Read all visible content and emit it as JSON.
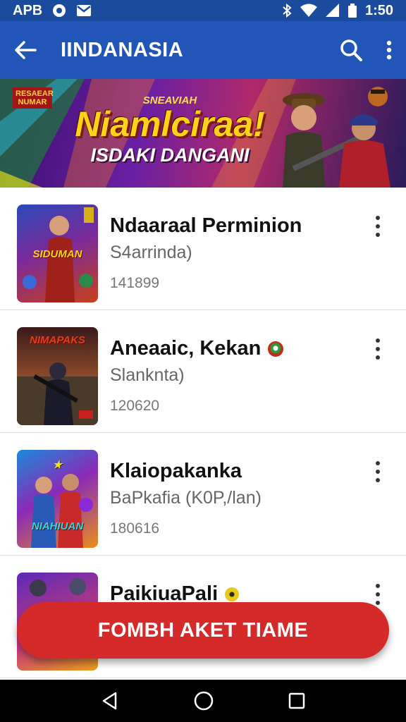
{
  "status_bar": {
    "left_text": "APB",
    "time": "1:50",
    "icons": [
      "media-circle-icon",
      "gmail-icon",
      "bluetooth-icon",
      "wifi-icon",
      "signal-icon",
      "battery-icon"
    ]
  },
  "app_bar": {
    "title": "IINDANASIA",
    "icons": [
      "back-arrow-icon",
      "search-icon",
      "more-vert-icon"
    ]
  },
  "banner": {
    "badge": "RESAEAR NUMAR",
    "kicker": "SNEAVIAH",
    "title": "Niamlciraa!",
    "subtitle": "ISDAKI DANGANI"
  },
  "list": {
    "items": [
      {
        "title": "Ndaaraal Perminion",
        "subtitle": "S4arrinda)",
        "count": "141899",
        "thumb_text": "SIDUMAN",
        "badge": ""
      },
      {
        "title": "Aneaaic, Kekan",
        "subtitle": "Slanknta)",
        "count": "120620",
        "thumb_text": "NIMAPAKS",
        "badge": "green-red-badge"
      },
      {
        "title": "Klaiopakanka",
        "subtitle": "BaPkafia (K0P,/lan)",
        "count": "180616",
        "thumb_text": "NIAHIUAN",
        "badge": ""
      },
      {
        "title": "PaikiuaPali",
        "subtitle": "",
        "count": "",
        "thumb_text": "",
        "badge": "yellow-badge"
      }
    ]
  },
  "cta": {
    "label": "FOMBH AKET TIAME"
  },
  "nav_bar": {
    "icons": [
      "back-triangle-icon",
      "home-circle-icon",
      "recents-square-icon"
    ]
  },
  "colors": {
    "app_bar": "#2156b8",
    "status_bar": "#1a4b9c",
    "cta": "#d42a2a",
    "nav_bar": "#000000"
  }
}
